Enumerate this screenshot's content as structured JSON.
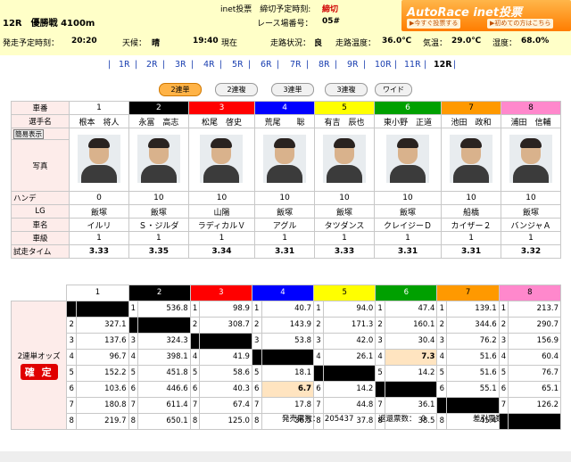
{
  "header": {
    "race_title": "12R　優勝戦 4100m",
    "vote_label": "inet投票　締切予定時刻:",
    "vote_status": "締切",
    "venue_label": "レース場番号：",
    "venue_number": "05#",
    "start_label": "発走予定時刻：",
    "start_time": "20:20",
    "weather_label": "天候：",
    "weather": "晴",
    "now_time": "19:40",
    "now_label": "現在",
    "track_label": "走路状況：",
    "track": "良",
    "road_temp_label": "走路温度：",
    "road_temp": "36.0℃",
    "air_temp_label": "気温：",
    "air_temp": "29.0℃",
    "humidity_label": "湿度：",
    "humidity": "68.0%"
  },
  "logo": {
    "title": "AutoRace",
    "title2": "inet投票",
    "btn1": "▶今すぐ投票する",
    "btn2": "▶初めての方はこちら"
  },
  "nav": [
    "1R",
    "2R",
    "3R",
    "4R",
    "5R",
    "6R",
    "7R",
    "8R",
    "9R",
    "10R",
    "11R",
    "12R"
  ],
  "tabs": [
    "2連単",
    "2連複",
    "3連単",
    "3連複",
    "ワイド"
  ],
  "labels": {
    "car_no": "車番",
    "name": "選手名",
    "simple": "簡易表示",
    "photo": "写真",
    "handicap": "ハンデ",
    "lg": "LG",
    "car_name": "車名",
    "class": "車級",
    "trial": "試走タイム",
    "odds": "2連単オッズ",
    "kakutei": "確 定"
  },
  "racers": [
    {
      "no": "1",
      "name": "根本　将人",
      "hande": "0",
      "lg": "飯塚",
      "car": "イルリ",
      "cls": "1",
      "trial": "3.33"
    },
    {
      "no": "2",
      "name": "永冨　高志",
      "hande": "10",
      "lg": "飯塚",
      "car": "Ｓ・ジルダ",
      "cls": "1",
      "trial": "3.35"
    },
    {
      "no": "3",
      "name": "松尾　啓史",
      "hande": "10",
      "lg": "山陽",
      "car": "ラディカルＶ",
      "cls": "1",
      "trial": "3.34"
    },
    {
      "no": "4",
      "name": "荒尾　　聡",
      "hande": "10",
      "lg": "飯塚",
      "car": "アグル",
      "cls": "1",
      "trial": "3.31"
    },
    {
      "no": "5",
      "name": "有吉　辰也",
      "hande": "10",
      "lg": "飯塚",
      "car": "タツダンス",
      "cls": "1",
      "trial": "3.33"
    },
    {
      "no": "6",
      "name": "東小野　正道",
      "hande": "10",
      "lg": "飯塚",
      "car": "クレイジーＤ",
      "cls": "1",
      "trial": "3.31"
    },
    {
      "no": "7",
      "name": "池田　政和",
      "hande": "10",
      "lg": "船橋",
      "car": "カイザー２",
      "cls": "1",
      "trial": "3.31"
    },
    {
      "no": "8",
      "name": "浦田　信輔",
      "hande": "10",
      "lg": "飯塚",
      "car": "バンジャＡ",
      "cls": "1",
      "trial": "3.32"
    }
  ],
  "car_colors": {
    "bg": [
      "#ffffff",
      "#000000",
      "#ff0000",
      "#0000ff",
      "#ffff00",
      "#00a000",
      "#ff9900",
      "#ff88cc"
    ],
    "fg": [
      "#000000",
      "#ffffff",
      "#ffffff",
      "#ffffff",
      "#000000",
      "#ffffff",
      "#000000",
      "#000000"
    ]
  },
  "odds": [
    [
      [
        "",
        ""
      ],
      [
        "1",
        "536.8"
      ],
      [
        "1",
        "98.9"
      ],
      [
        "1",
        "40.7"
      ],
      [
        "1",
        "94.0"
      ],
      [
        "1",
        "47.4"
      ],
      [
        "1",
        "139.1"
      ],
      [
        "1",
        "213.7"
      ]
    ],
    [
      [
        "2",
        "327.1"
      ],
      [
        "",
        ""
      ],
      [
        "2",
        "308.7"
      ],
      [
        "2",
        "143.9"
      ],
      [
        "2",
        "171.3"
      ],
      [
        "2",
        "160.1"
      ],
      [
        "2",
        "344.6"
      ],
      [
        "2",
        "290.7"
      ]
    ],
    [
      [
        "3",
        "137.6"
      ],
      [
        "3",
        "324.3"
      ],
      [
        "",
        ""
      ],
      [
        "3",
        "53.8"
      ],
      [
        "3",
        "42.0"
      ],
      [
        "3",
        "30.4"
      ],
      [
        "3",
        "76.2"
      ],
      [
        "3",
        "156.9"
      ]
    ],
    [
      [
        "4",
        "96.7"
      ],
      [
        "4",
        "398.1"
      ],
      [
        "4",
        "41.9"
      ],
      [
        "",
        ""
      ],
      [
        "4",
        "26.1"
      ],
      [
        "4",
        "7.3"
      ],
      [
        "4",
        "51.6"
      ],
      [
        "4",
        "60.4"
      ]
    ],
    [
      [
        "5",
        "152.2"
      ],
      [
        "5",
        "451.8"
      ],
      [
        "5",
        "58.6"
      ],
      [
        "5",
        "18.1"
      ],
      [
        "",
        ""
      ],
      [
        "5",
        "14.2"
      ],
      [
        "5",
        "51.6"
      ],
      [
        "5",
        "76.7"
      ]
    ],
    [
      [
        "6",
        "103.6"
      ],
      [
        "6",
        "446.6"
      ],
      [
        "6",
        "40.3"
      ],
      [
        "6",
        "6.7"
      ],
      [
        "6",
        "14.2"
      ],
      [
        "",
        ""
      ],
      [
        "6",
        "55.1"
      ],
      [
        "6",
        "65.1"
      ]
    ],
    [
      [
        "7",
        "180.8"
      ],
      [
        "7",
        "611.4"
      ],
      [
        "7",
        "67.4"
      ],
      [
        "7",
        "17.8"
      ],
      [
        "7",
        "44.8"
      ],
      [
        "7",
        "36.1"
      ],
      [
        "",
        ""
      ],
      [
        "7",
        "126.2"
      ]
    ],
    [
      [
        "8",
        "219.7"
      ],
      [
        "8",
        "650.1"
      ],
      [
        "8",
        "125.0"
      ],
      [
        "8",
        "36.5"
      ],
      [
        "8",
        "37.8"
      ],
      [
        "8",
        "38.5"
      ],
      [
        "8",
        "45.4"
      ],
      [
        "",
        ""
      ]
    ]
  ],
  "highlight": [
    [
      5,
      3
    ],
    [
      3,
      5
    ]
  ],
  "footer": {
    "sold_label": "発売票数：",
    "sold": "205437",
    "refund_label": "返還票数：",
    "refund": "0",
    "net_label": "差引票数：",
    "net": "205437"
  }
}
